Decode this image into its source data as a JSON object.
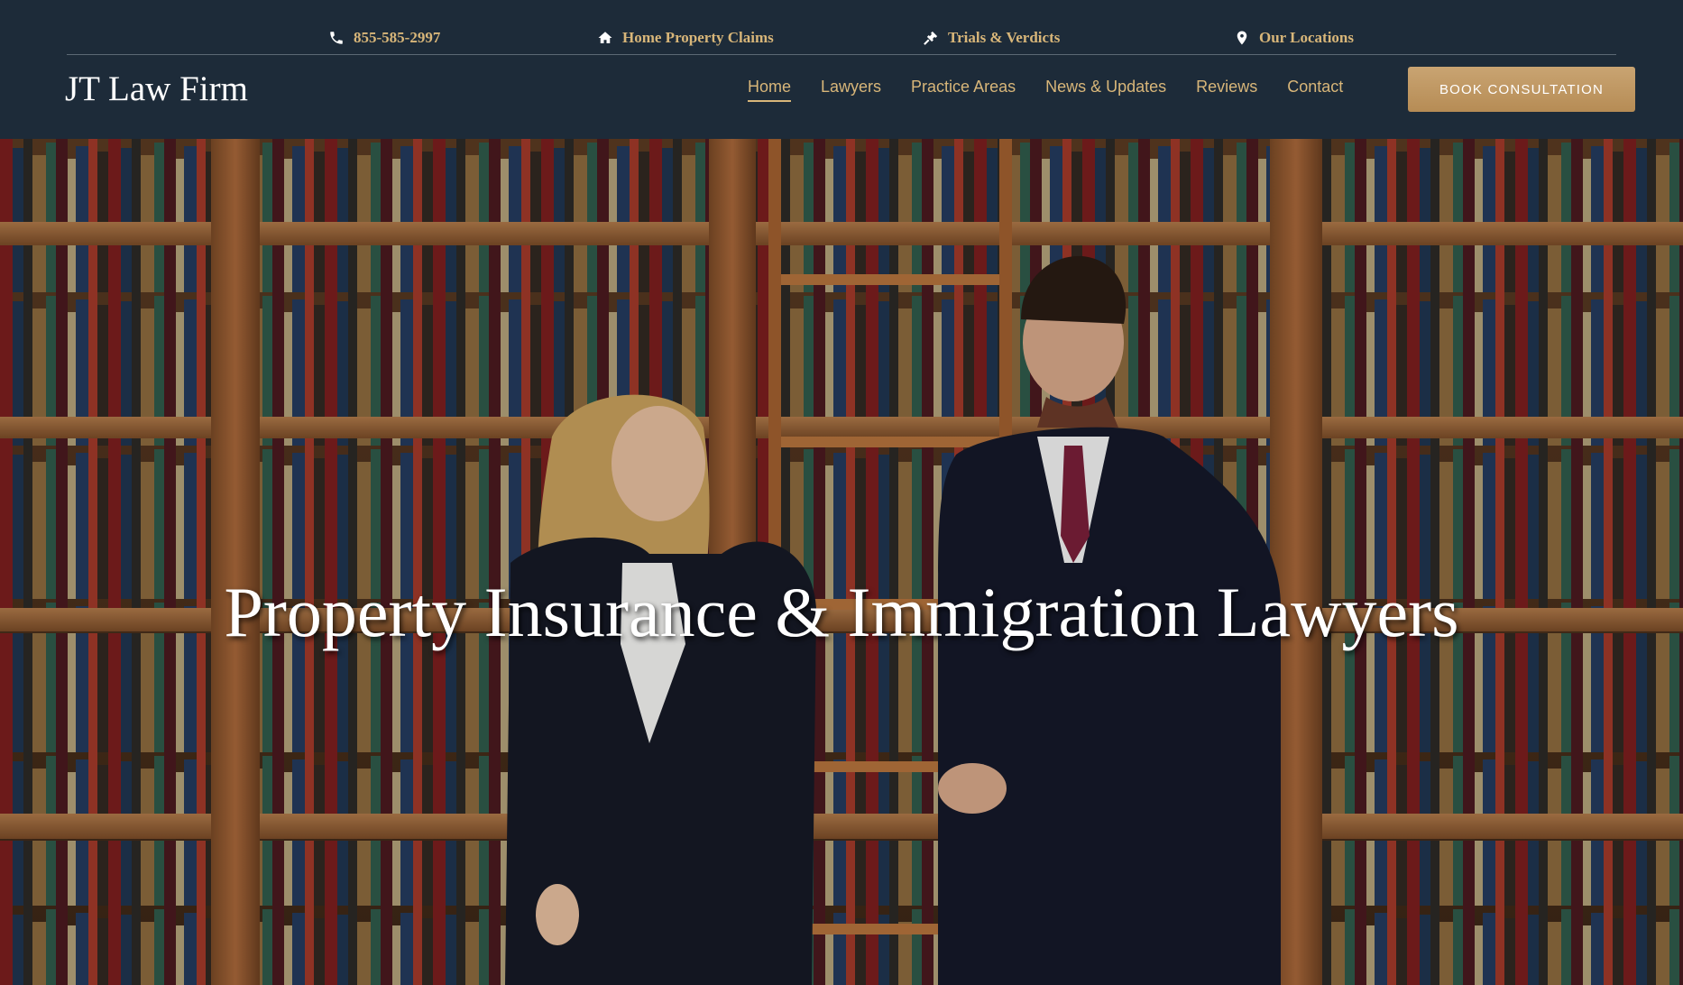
{
  "topbar": {
    "phone": "855-585-2997",
    "claims": "Home Property Claims",
    "trials": "Trials & Verdicts",
    "locations": "Our Locations"
  },
  "brand": {
    "name": "JT Law Firm"
  },
  "nav": {
    "home": "Home",
    "lawyers": "Lawyers",
    "practice_areas": "Practice Areas",
    "news": "News & Updates",
    "reviews": "Reviews",
    "contact": "Contact"
  },
  "cta": {
    "label": "BOOK CONSULTATION"
  },
  "hero": {
    "headline": "Property Insurance & Immigration Lawyers"
  },
  "colors": {
    "header_bg": "#1d2b39",
    "accent_gold": "#d8b679",
    "button_gold": "#b68c55"
  }
}
